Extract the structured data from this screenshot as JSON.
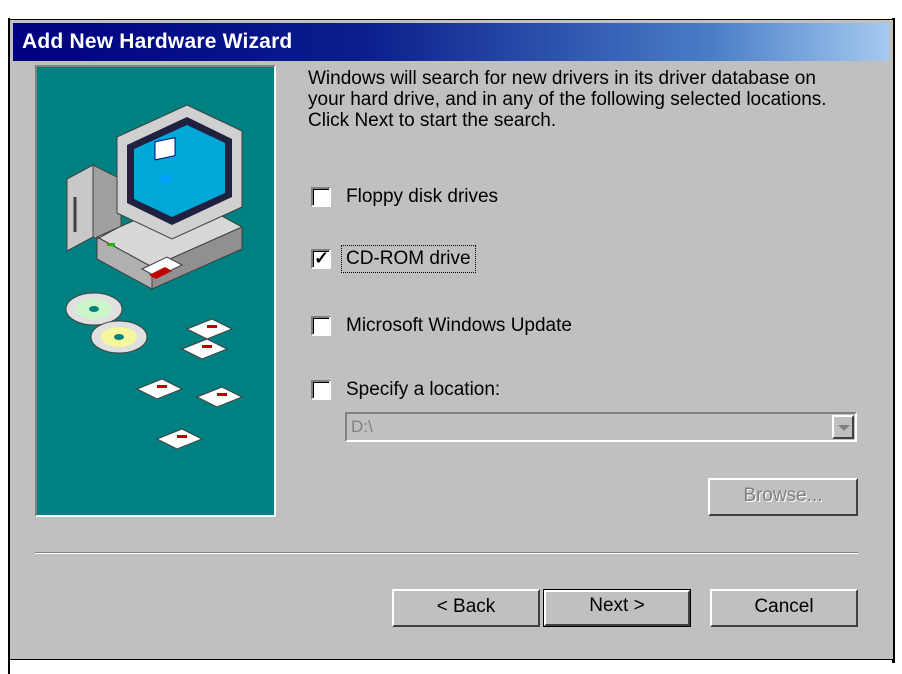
{
  "window": {
    "title": "Add New Hardware Wizard"
  },
  "description": "Windows will search for new drivers in its driver database on your hard drive, and in any of the following selected locations. Click Next to start the search.",
  "options": [
    {
      "label": "Floppy disk drives",
      "checked": false
    },
    {
      "label": "CD-ROM drive",
      "checked": true
    },
    {
      "label": "Microsoft Windows Update",
      "checked": false
    },
    {
      "label": "Specify a location:",
      "checked": false
    }
  ],
  "location": {
    "value": "D:\\",
    "enabled": false
  },
  "buttons": {
    "browse": "Browse...",
    "back": "< Back",
    "next": "Next >",
    "cancel": "Cancel"
  },
  "colors": {
    "titlebar": "#000080",
    "illustration_bg": "#008080",
    "dialog_bg": "#c0c0c0"
  }
}
